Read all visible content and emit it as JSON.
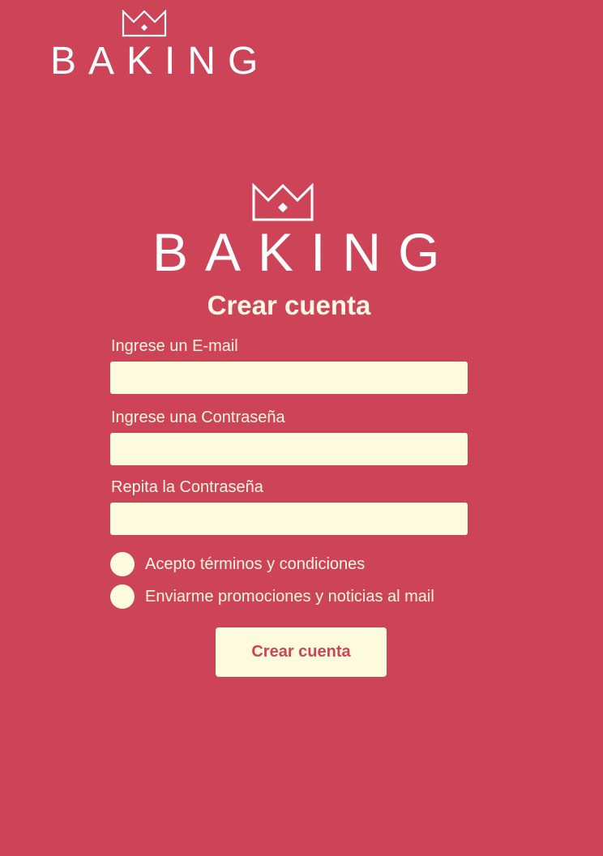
{
  "brand": {
    "name": "BAKING",
    "logo_icon": "crown-icon",
    "color": "#ffffff"
  },
  "form": {
    "title": "Crear cuenta",
    "email_label": "Ingrese un E-mail",
    "email_value": "",
    "password_label": "Ingrese una Contraseña",
    "password_value": "",
    "repeat_label": "Repita la Contraseña",
    "repeat_value": "",
    "terms_label": "Acepto términos y condiciones",
    "promo_label": "Enviarme promociones y noticias al mail",
    "submit_label": "Crear cuenta"
  },
  "colors": {
    "background": "#cd4358",
    "input_fill": "#fdfbdd",
    "text": "#fdf6e3"
  }
}
